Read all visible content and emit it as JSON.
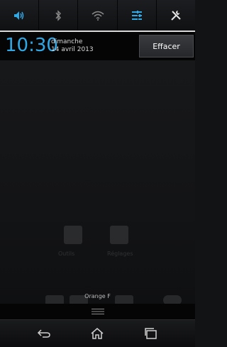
{
  "quick_settings": {
    "items": [
      {
        "name": "Son",
        "icon": "volume-icon",
        "active": true
      },
      {
        "name": "Bluetooth",
        "icon": "bluetooth-icon",
        "active": false
      },
      {
        "name": "Wi-Fi",
        "icon": "wifi-icon",
        "active": false
      },
      {
        "name": "Synchronisation",
        "icon": "sync-settings-icon",
        "active": true
      },
      {
        "name": "Réglages",
        "icon": "tools-icon",
        "active": false
      }
    ]
  },
  "header": {
    "time": "10:30",
    "day": "dimanche",
    "date": "14 avril 2013",
    "clear_label": "Effacer"
  },
  "home_ghost": {
    "labels": [
      "Outils",
      "Réglages"
    ]
  },
  "status": {
    "carrier": "Orange F"
  },
  "colors": {
    "accent": "#2fa8e6",
    "background": "#121315",
    "header": "#050506"
  }
}
